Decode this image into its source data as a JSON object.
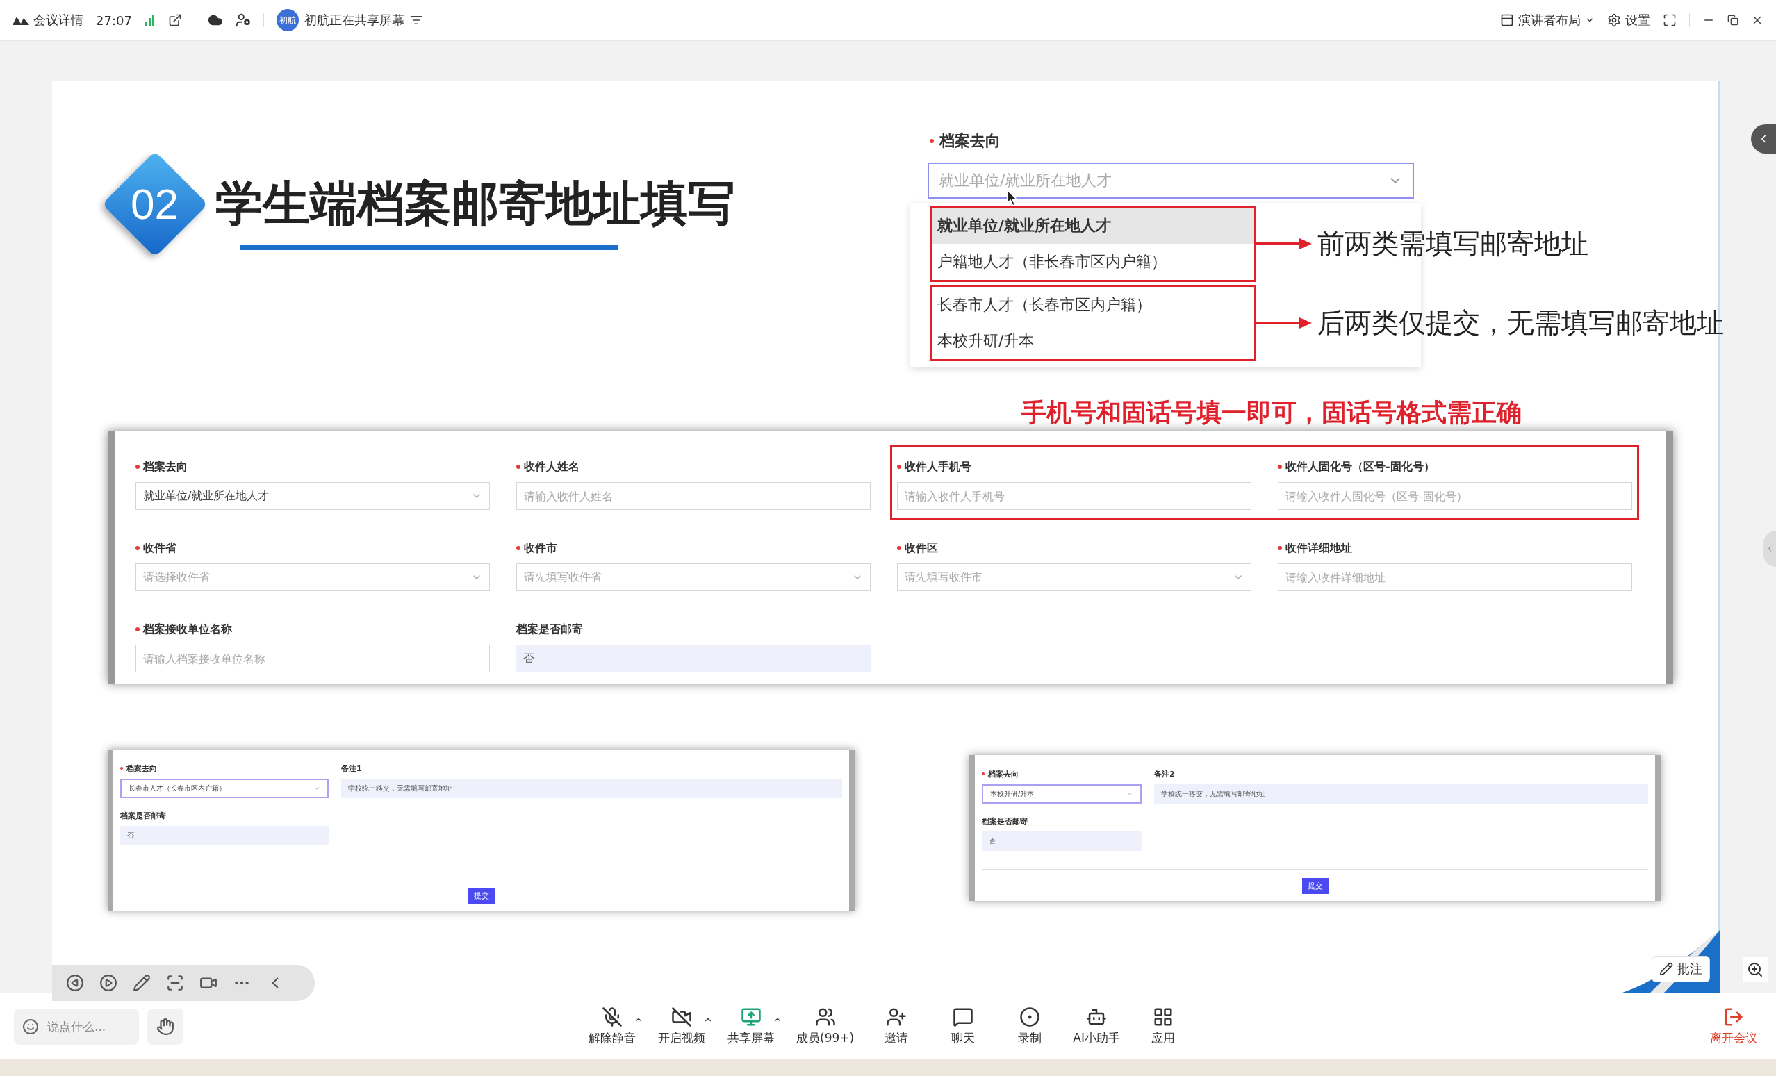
{
  "top_bar": {
    "meeting_info": "会议详情",
    "duration": "27:07",
    "sharer_avatar": "初航",
    "sharing_status": "初航正在共享屏幕",
    "layout_menu": "演讲者布局",
    "settings": "设置"
  },
  "slide": {
    "section_number": "02",
    "title": "学生端档案邮寄地址填写",
    "dropdown_demo": {
      "label": "档案去向",
      "required": true,
      "placeholder": "就业单位/就业所在地人才",
      "groups": [
        {
          "note": "前两类需填写邮寄地址",
          "options": [
            {
              "label": "就业单位/就业所在地人才",
              "selected": true
            },
            {
              "label": "户籍地人才（非长春市区内户籍）",
              "selected": false
            }
          ]
        },
        {
          "note": "后两类仅提交，无需填写邮寄地址",
          "options": [
            {
              "label": "长春市人才（长春市区内户籍）",
              "selected": false
            },
            {
              "label": "本校升研/升本",
              "selected": false
            }
          ]
        }
      ]
    },
    "form_note": "手机号和固话号填一即可，固话号格式需正确",
    "form": {
      "fields": [
        {
          "label": "档案去向",
          "required": true,
          "kind": "select",
          "value": "就业单位/就业所在地人才",
          "highlighted": false
        },
        {
          "label": "收件人姓名",
          "required": true,
          "kind": "input",
          "placeholder": "请输入收件人姓名",
          "highlighted": false
        },
        {
          "label": "收件人手机号",
          "required": true,
          "kind": "input",
          "placeholder": "请输入收件人手机号",
          "highlighted": true
        },
        {
          "label": "收件人固化号（区号-固化号）",
          "required": true,
          "kind": "input",
          "placeholder": "请输入收件人固化号（区号-固化号）",
          "highlighted": true
        },
        {
          "label": "收件省",
          "required": true,
          "kind": "select",
          "placeholder": "请选择收件省",
          "highlighted": false
        },
        {
          "label": "收件市",
          "required": true,
          "kind": "select",
          "placeholder": "请先填写收件省",
          "highlighted": false
        },
        {
          "label": "收件区",
          "required": true,
          "kind": "select",
          "placeholder": "请先填写收件市",
          "highlighted": false
        },
        {
          "label": "收件详细地址",
          "required": true,
          "kind": "input",
          "placeholder": "请输入收件详细地址",
          "highlighted": false
        },
        {
          "label": "档案接收单位名称",
          "required": true,
          "kind": "input",
          "placeholder": "请输入档案接收单位名称",
          "highlighted": false
        },
        {
          "label": "档案是否邮寄",
          "required": false,
          "kind": "readonly",
          "value": "否",
          "highlighted": false
        }
      ]
    },
    "mini_forms": [
      {
        "select": {
          "label": "档案去向",
          "value": "长春市人才（长春市区内户籍）"
        },
        "remark": {
          "label": "备注1",
          "value": "学校统一移交，无需填写邮寄地址"
        },
        "mail": {
          "label": "档案是否邮寄",
          "value": "否"
        },
        "button": "提交"
      },
      {
        "select": {
          "label": "档案去向",
          "value": "本校升研/升本"
        },
        "remark": {
          "label": "备注2",
          "value": "学校统一移交，无需填写邮寄地址"
        },
        "mail": {
          "label": "档案是否邮寄",
          "value": "否"
        },
        "button": "提交"
      }
    ]
  },
  "annotate_button": "批注",
  "message_input": {
    "placeholder": "说点什么..."
  },
  "toolbar": [
    {
      "kind": "mic",
      "label": "解除静音",
      "has_menu": true
    },
    {
      "kind": "video",
      "label": "开启视频",
      "has_menu": true
    },
    {
      "kind": "share",
      "label": "共享屏幕",
      "has_menu": true
    },
    {
      "kind": "members",
      "label": "成员(99+)",
      "has_menu": false
    },
    {
      "kind": "invite",
      "label": "邀请",
      "has_menu": false
    },
    {
      "kind": "chat",
      "label": "聊天",
      "has_menu": false
    },
    {
      "kind": "record",
      "label": "录制",
      "has_menu": false
    },
    {
      "kind": "ai",
      "label": "AI小助手",
      "has_menu": false
    },
    {
      "kind": "apps",
      "label": "应用",
      "has_menu": false
    }
  ],
  "leave_button": "离开会议"
}
